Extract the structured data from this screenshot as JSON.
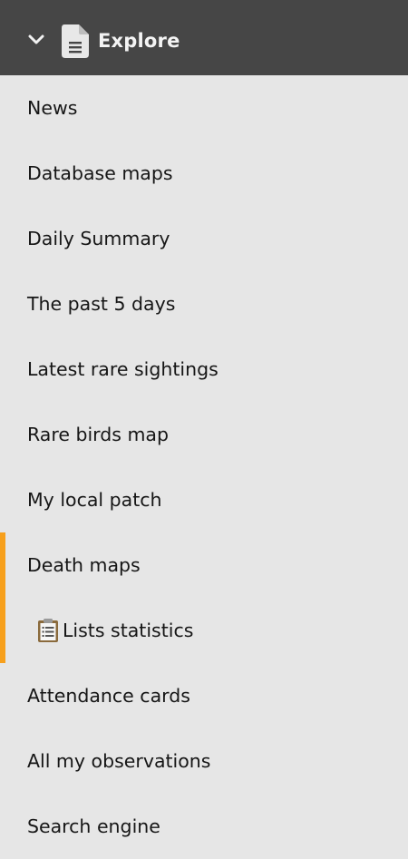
{
  "header": {
    "title": "Explore",
    "expand_icon": "chevron-down-icon",
    "section_icon": "document-icon"
  },
  "menu": {
    "items": [
      {
        "label": "News"
      },
      {
        "label": "Database maps"
      },
      {
        "label": "Daily Summary"
      },
      {
        "label": "The past 5 days"
      },
      {
        "label": "Latest rare sightings"
      },
      {
        "label": "Rare birds map"
      },
      {
        "label": "My local patch"
      },
      {
        "label": "Death maps"
      },
      {
        "label": "Lists statistics",
        "icon": "clipboard-icon"
      },
      {
        "label": "Attendance cards"
      },
      {
        "label": "All my observations"
      },
      {
        "label": "Search engine"
      }
    ]
  },
  "colors": {
    "header_bg": "#464646",
    "menu_bg": "#e6e6e6",
    "accent": "#f7a01c",
    "text": "#161616"
  }
}
